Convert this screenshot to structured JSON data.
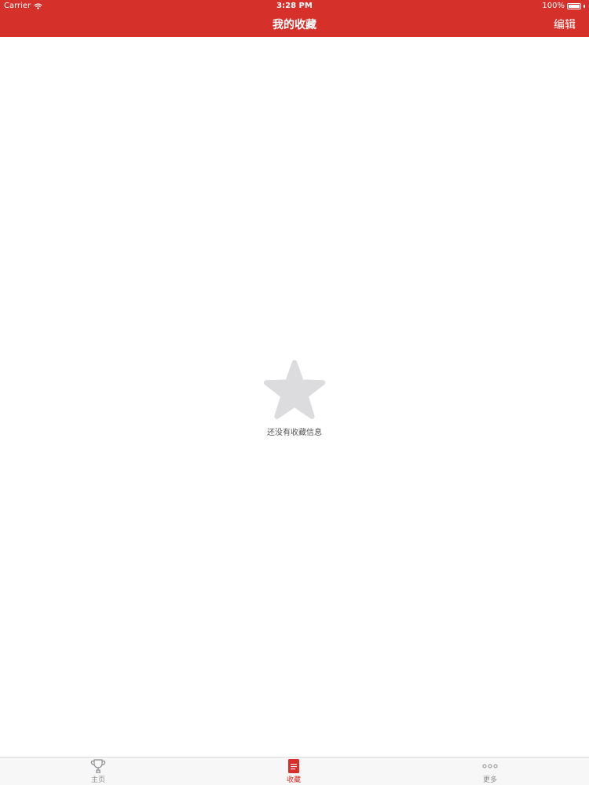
{
  "status_bar": {
    "carrier": "Carrier",
    "time": "3:28 PM",
    "battery": "100%"
  },
  "nav": {
    "title": "我的收藏",
    "edit_label": "编辑"
  },
  "empty_state": {
    "icon": "star-icon",
    "message": "还没有收藏信息"
  },
  "tabbar": {
    "items": [
      {
        "label": "主页",
        "icon": "trophy-icon",
        "selected": false
      },
      {
        "label": "收藏",
        "icon": "document-icon",
        "selected": true
      },
      {
        "label": "更多",
        "icon": "more-dots-icon",
        "selected": false
      }
    ]
  },
  "colors": {
    "brand": "#d6302b",
    "tab_inactive": "#8e8e93",
    "star": "#dcdcdf"
  }
}
